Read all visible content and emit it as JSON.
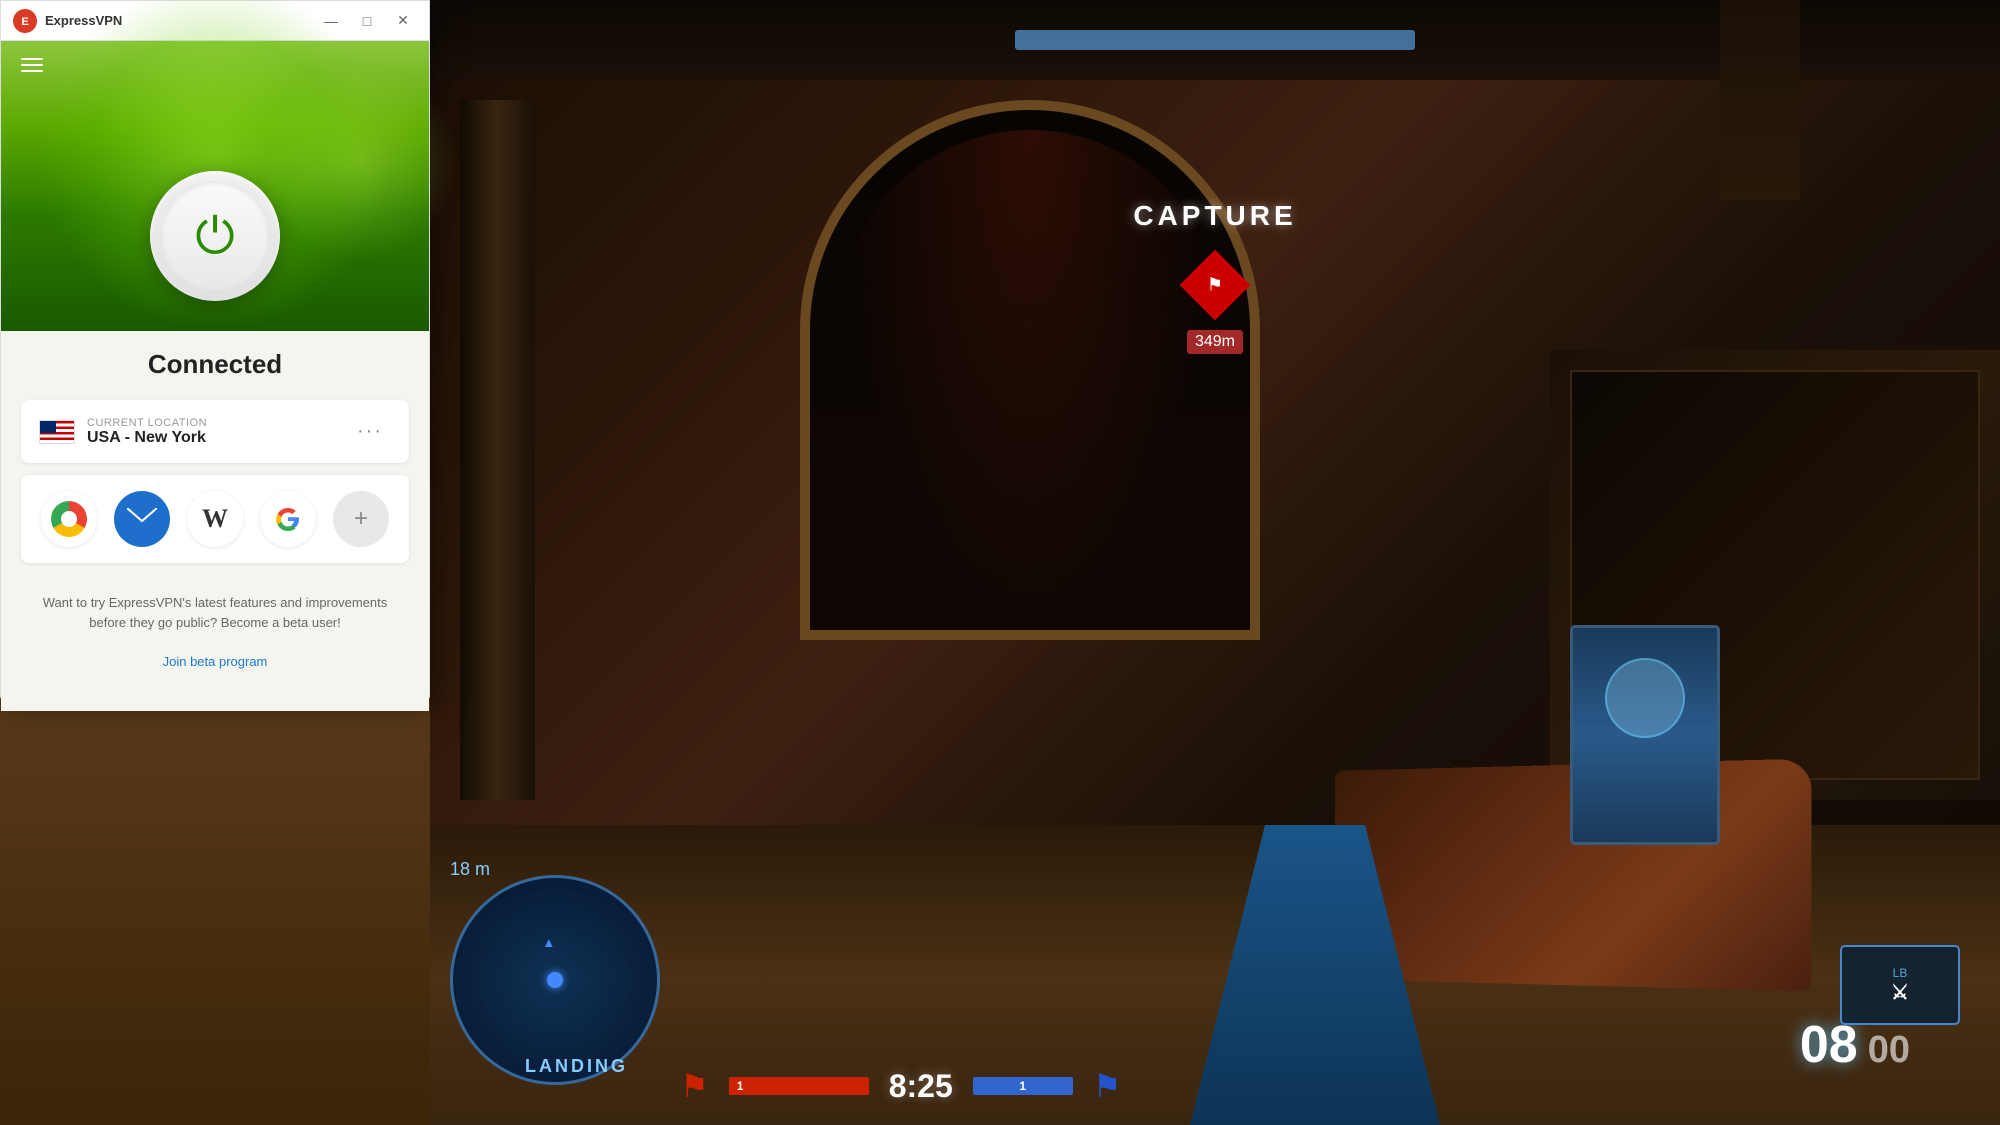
{
  "window": {
    "title": "ExpressVPN",
    "logo_text": "E",
    "controls": {
      "minimize": "—",
      "maximize": "□",
      "close": "✕"
    }
  },
  "vpn": {
    "status": "Connected",
    "header_bg_color": "#5ba800",
    "location_card": {
      "label": "Current Location",
      "country": "USA",
      "city": "New York",
      "display": "USA - New York"
    },
    "app_shortcuts": [
      {
        "name": "Chrome",
        "type": "chrome"
      },
      {
        "name": "Mail",
        "type": "mail"
      },
      {
        "name": "Wikipedia",
        "type": "wiki",
        "letter": "W"
      },
      {
        "name": "Google",
        "type": "google"
      },
      {
        "name": "Add",
        "type": "add",
        "symbol": "+"
      }
    ],
    "beta_text": "Want to try ExpressVPN's latest features and improvements before they go public? Become a beta user!",
    "beta_link": "Join beta program"
  },
  "game": {
    "capture_text": "CAPTURE",
    "distance": "349m",
    "timer": "8:25",
    "score_red": "1",
    "score_blue": "1",
    "ammo_current": "08",
    "ammo_reserve": "00",
    "minimap_label": "LANDING",
    "minimap_dist": "18 m"
  },
  "hamburger": {
    "aria": "menu"
  }
}
